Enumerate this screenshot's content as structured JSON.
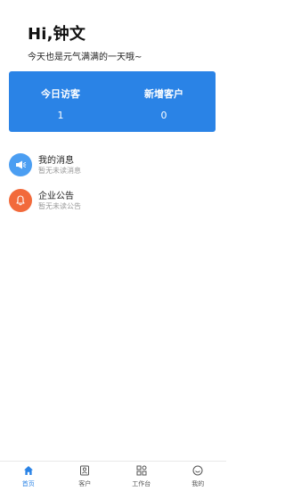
{
  "header": {
    "greeting": "Hi,钟文",
    "subtitle": "今天也是元气满满的一天哦~"
  },
  "stats": {
    "visitors_label": "今日访客",
    "visitors_value": "1",
    "new_customers_label": "新增客户",
    "new_customers_value": "0"
  },
  "list": [
    {
      "title": "我的消息",
      "subtitle": "暂无未读消息",
      "icon": "megaphone-icon",
      "color": "#4b9ef2"
    },
    {
      "title": "企业公告",
      "subtitle": "暂无未读公告",
      "icon": "bell-icon",
      "color": "#f26a3b"
    }
  ],
  "tabbar": [
    {
      "label": "首页",
      "icon": "home-icon",
      "active": true
    },
    {
      "label": "客户",
      "icon": "contact-card-icon",
      "active": false
    },
    {
      "label": "工作台",
      "icon": "grid-icon",
      "active": false
    },
    {
      "label": "我的",
      "icon": "smiley-icon",
      "active": false
    }
  ],
  "colors": {
    "accent": "#2a83e6",
    "message_icon_bg": "#4b9ef2",
    "notice_icon_bg": "#f26a3b"
  }
}
